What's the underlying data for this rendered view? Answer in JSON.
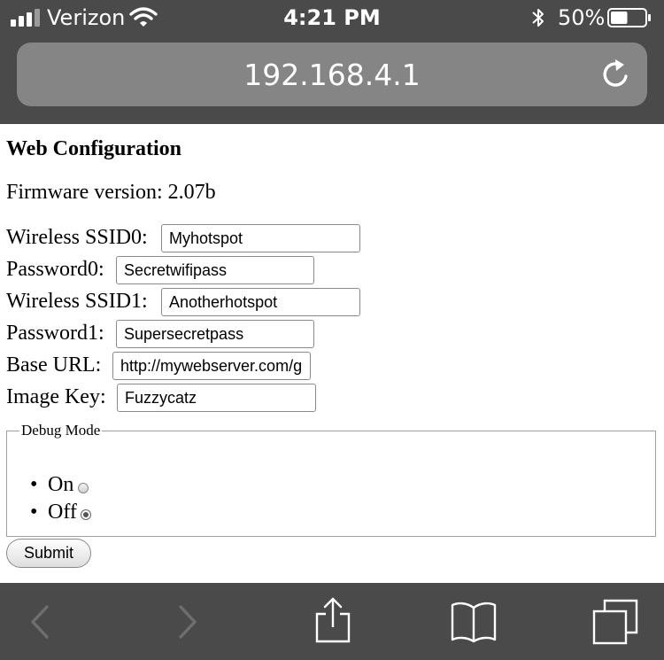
{
  "status_bar": {
    "carrier": "Verizon",
    "time": "4:21 PM",
    "battery_percent": "50%",
    "battery_level": 0.5,
    "icons": [
      "signal-icon",
      "wifi-icon",
      "bluetooth-icon",
      "battery-icon"
    ]
  },
  "url_bar": {
    "url": "192.168.4.1",
    "reload_icon": "reload-icon"
  },
  "page": {
    "title": "Web Configuration",
    "firmware": "Firmware version: 2.07b",
    "fields": [
      {
        "label": "Wireless SSID0:",
        "value": "Myhotspot"
      },
      {
        "label": "Password0:",
        "value": "Secretwifipass"
      },
      {
        "label": "Wireless SSID1:",
        "value": "Anotherhotspot"
      },
      {
        "label": "Password1:",
        "value": "Supersecretpass"
      },
      {
        "label": "Base URL:",
        "value": "http://mywebserver.com/g"
      },
      {
        "label": "Image Key:",
        "value": "Fuzzycatz"
      }
    ],
    "debug": {
      "legend": "Debug Mode",
      "options": [
        {
          "label": "On",
          "selected": false
        },
        {
          "label": "Off",
          "selected": true
        }
      ]
    },
    "submit_label": "Submit"
  },
  "toolbar": {
    "icons": [
      "back-icon",
      "forward-icon",
      "share-icon",
      "bookmarks-icon",
      "tabs-icon"
    ]
  },
  "colors": {
    "chrome_background": "#4a4a4a",
    "url_field": "#858585",
    "page_background": "#ffffff"
  }
}
